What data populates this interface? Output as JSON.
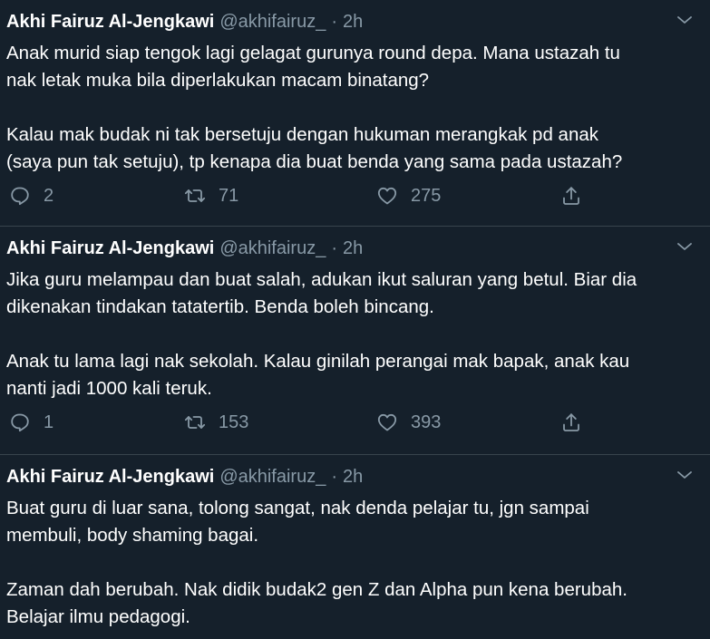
{
  "tweets": [
    {
      "display_name": "Akhi Fairuz Al-Jengkawi",
      "handle": "@akhifairuz_",
      "separator": "·",
      "time": "2h",
      "paragraphs": [
        "Anak murid siap tengok lagi gelagat gurunya round depa. Mana ustazah tu\nnak letak muka bila diperlakukan macam binatang?",
        "Kalau mak budak ni tak bersetuju dengan hukuman merangkak pd anak\n(saya pun tak setuju), tp kenapa dia buat benda yang sama pada ustazah?"
      ],
      "replies": "2",
      "retweets": "71",
      "likes": "275"
    },
    {
      "display_name": "Akhi Fairuz Al-Jengkawi",
      "handle": "@akhifairuz_",
      "separator": "·",
      "time": "2h",
      "paragraphs": [
        "Jika guru melampau dan buat salah, adukan ikut saluran yang betul. Biar dia\ndikenakan tindakan tatatertib. Benda boleh bincang.",
        "Anak tu lama lagi nak sekolah. Kalau ginilah perangai mak bapak, anak kau\nnanti jadi 1000 kali teruk."
      ],
      "replies": "1",
      "retweets": "153",
      "likes": "393"
    },
    {
      "display_name": "Akhi Fairuz Al-Jengkawi",
      "handle": "@akhifairuz_",
      "separator": "·",
      "time": "2h",
      "paragraphs": [
        "Buat guru di luar sana, tolong sangat, nak denda pelajar tu, jgn sampai\nmembuli, body shaming bagai.",
        "Zaman dah berubah. Nak didik budak2 gen Z dan Alpha pun kena berubah.\nBelajar ilmu pedagogi."
      ]
    }
  ],
  "icons": {
    "reply": "reply-icon",
    "retweet": "retweet-icon",
    "like": "like-icon",
    "share": "share-icon",
    "caret": "chevron-down-icon"
  },
  "colors": {
    "background": "#15202b",
    "text": "#ffffff",
    "secondary": "#8899a6",
    "divider": "#38444d"
  }
}
